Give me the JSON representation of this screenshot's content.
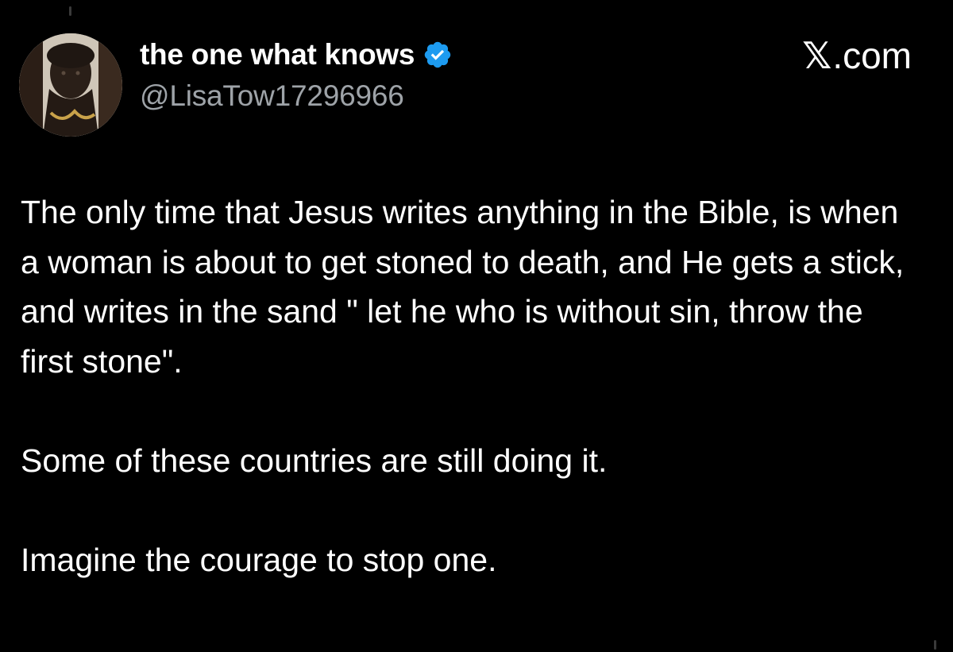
{
  "tweet": {
    "author": {
      "display_name": "the one what knows",
      "handle": "@LisaTow17296966",
      "verified": true
    },
    "watermark": {
      "x_glyph": "𝕏",
      "domain": ".com"
    },
    "paragraphs": [
      "The only time that Jesus writes anything in the Bible, is when a woman is about to get stoned to death, and He gets a stick, and writes in the sand \" let he who is without sin, throw the first stone\".",
      "Some of these countries are still doing it.",
      "Imagine the courage to stop one."
    ]
  },
  "colors": {
    "background": "#000000",
    "text_primary": "#ffffff",
    "text_secondary": "#9ea3a8",
    "verified_badge": "#1d9bf0"
  },
  "icons": {
    "verified": "verified-badge-icon",
    "avatar": "profile-avatar-image"
  }
}
